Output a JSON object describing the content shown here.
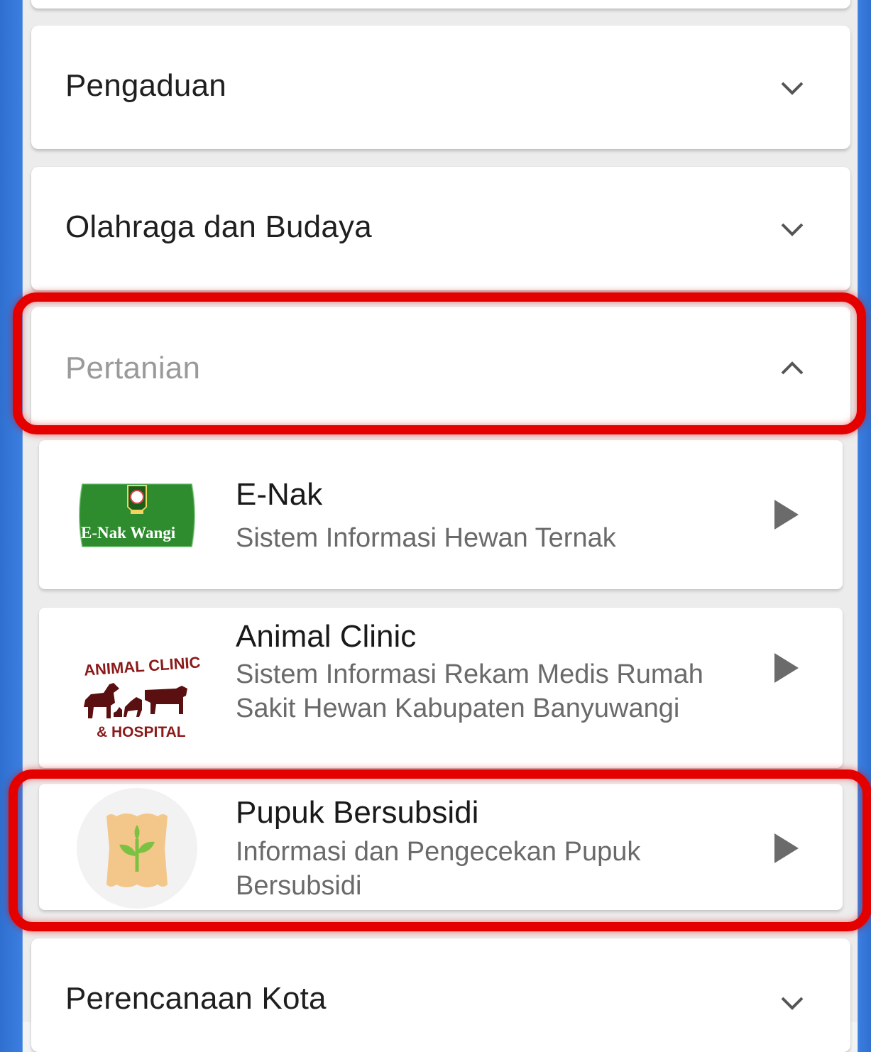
{
  "categories": [
    {
      "title": "Pengaduan",
      "state": "collapsed"
    },
    {
      "title": "Olahraga dan Budaya",
      "state": "collapsed"
    },
    {
      "title": "Pertanian",
      "state": "expanded"
    },
    {
      "title": "Perencanaan Kota",
      "state": "collapsed"
    }
  ],
  "pertanian_apps": [
    {
      "title": "E-Nak",
      "description": "Sistem Informasi Hewan Ternak",
      "logo_text": "E-Nak Wangi",
      "icon": "enak-wangi-logo"
    },
    {
      "title": "Animal Clinic",
      "description": "Sistem Informasi Rekam Medis Rumah Sakit Hewan Kabupaten Banyuwangi",
      "logo_text_top": "ANIMAL CLINIC",
      "logo_text_bottom": "& HOSPITAL",
      "icon": "animal-clinic-logo"
    },
    {
      "title": "Pupuk Bersubsidi",
      "description": "Informasi dan Pengecekan Pupuk Bersubsidi",
      "icon": "fertilizer-sack-icon"
    }
  ],
  "colors": {
    "highlight": "#e50000",
    "side_bar": "#3b7fe0",
    "enak_green": "#2e8b2e",
    "clinic_text": "#8b1a1a"
  }
}
